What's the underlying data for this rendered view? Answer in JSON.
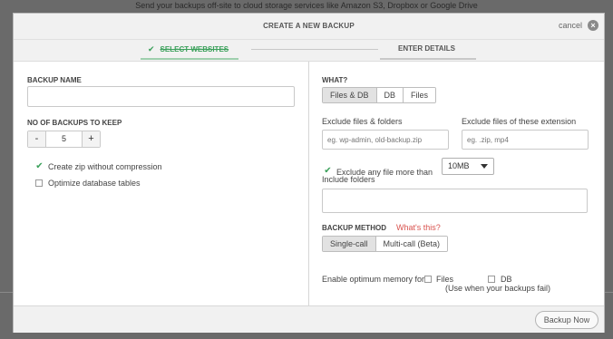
{
  "backdrop": {
    "text": "Send your backups off-site to cloud storage services like Amazon S3, Dropbox or Google Drive"
  },
  "modal": {
    "title": "CREATE A NEW BACKUP",
    "cancel_label": "cancel",
    "cancel_icon": "close-icon"
  },
  "steps": {
    "step1_label": "SELECT WEBSITES",
    "step1_icon": "✔",
    "step2_label": "ENTER DETAILS"
  },
  "left": {
    "backup_name_label": "BACKUP NAME",
    "backup_name_value": "",
    "backups_to_keep_label": "NO OF BACKUPS TO KEEP",
    "stepper_minus": "-",
    "stepper_value": "5",
    "stepper_plus": "+",
    "option_zip_label": "Create zip without compression",
    "option_zip_checked": true,
    "option_optimize_label": "Optimize database tables",
    "option_optimize_checked": false
  },
  "right": {
    "what_label": "WHAT?",
    "what_options": [
      "Files & DB",
      "DB",
      "Files"
    ],
    "what_selected": "Files & DB",
    "exclude_files_label": "Exclude files & folders",
    "exclude_files_placeholder": "eg. wp-admin, old-backup.zip",
    "exclude_ext_label": "Exclude files of these extension",
    "exclude_ext_placeholder": "eg. .zip, mp4",
    "exclude_size_label": "Exclude any file more than",
    "exclude_size_checked": true,
    "exclude_size_value": "10MB",
    "include_folders_label": "Include folders",
    "include_folders_value": "",
    "backup_method_label": "BACKUP METHOD",
    "whats_this": "What's this?",
    "method_options": [
      "Single-call",
      "Multi-call (Beta)"
    ],
    "method_selected": "Single-call",
    "optimum_memory_label": "Enable optimum memory for",
    "memory_files_label": "Files",
    "memory_db_label": "DB",
    "memory_note": "(Use when your backups fail)"
  },
  "footer": {
    "backup_now_label": "Backup Now"
  },
  "colors": {
    "accent_green": "#3aa05a",
    "link_red": "#d9534f"
  }
}
